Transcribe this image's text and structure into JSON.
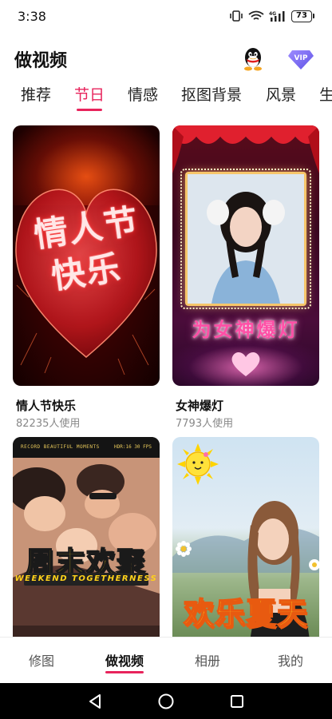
{
  "status_bar": {
    "time": "3:38",
    "network": "4G",
    "battery": "73"
  },
  "header": {
    "title": "做视频"
  },
  "tabs": [
    {
      "label": "推荐",
      "active": false
    },
    {
      "label": "节日",
      "active": true
    },
    {
      "label": "情感",
      "active": false
    },
    {
      "label": "抠图背景",
      "active": false
    },
    {
      "label": "风景",
      "active": false
    },
    {
      "label": "生",
      "active": false
    }
  ],
  "cards": [
    {
      "title": "情人节快乐",
      "usage": "82235人使用",
      "overlay_line1": "情人节",
      "overlay_line2": "快乐"
    },
    {
      "title": "女神爆灯",
      "usage": "7793人使用",
      "overlay": "为女神爆灯"
    },
    {
      "title": "",
      "usage": "",
      "top_left": "RECORD BEAUTIFUL MOMENTS",
      "top_right": "HDR:16 30 FPS",
      "overlay_main": "周末欢聚",
      "overlay_sub": "WEEKEND TOGETHERNESS"
    },
    {
      "title": "",
      "usage": "",
      "overlay": "欢乐夏天"
    }
  ],
  "bottom_nav": [
    {
      "label": "修图",
      "active": false
    },
    {
      "label": "做视频",
      "active": true
    },
    {
      "label": "相册",
      "active": false
    },
    {
      "label": "我的",
      "active": false
    }
  ],
  "colors": {
    "accent": "#e8245c",
    "vip": "#7b6cf6"
  }
}
